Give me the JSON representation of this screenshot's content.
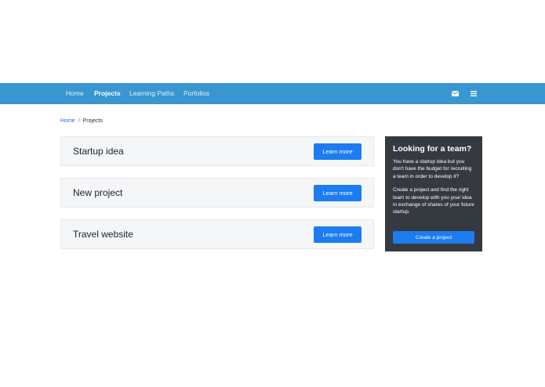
{
  "nav": {
    "items": [
      {
        "label": "Home",
        "active": false
      },
      {
        "label": "Projects",
        "active": true
      },
      {
        "label": "Learning Paths",
        "active": false
      },
      {
        "label": "Porfolios",
        "active": false
      }
    ],
    "icons": [
      "envelope-icon",
      "menu-icon"
    ]
  },
  "breadcrumb": {
    "home": "Home",
    "separator": "/",
    "current": "Projects"
  },
  "projects": [
    {
      "title": "Startup idea",
      "button": "Learn more"
    },
    {
      "title": "New project",
      "button": "Learn more"
    },
    {
      "title": "Travel website",
      "button": "Learn more"
    }
  ],
  "sidebar": {
    "title": "Looking for a team?",
    "paragraph1": "You have a startup idea but you don't have the budget for recruiting a team in order to develop it?",
    "paragraph2": "Create a project and find the right team to develop with you your idea in exchange of shares of your future startup.",
    "button": "Create a project"
  },
  "colors": {
    "navbar": "#3a96d0",
    "primary": "#1c7cf0",
    "sidebar": "#343a40",
    "card": "#f4f6f8"
  }
}
